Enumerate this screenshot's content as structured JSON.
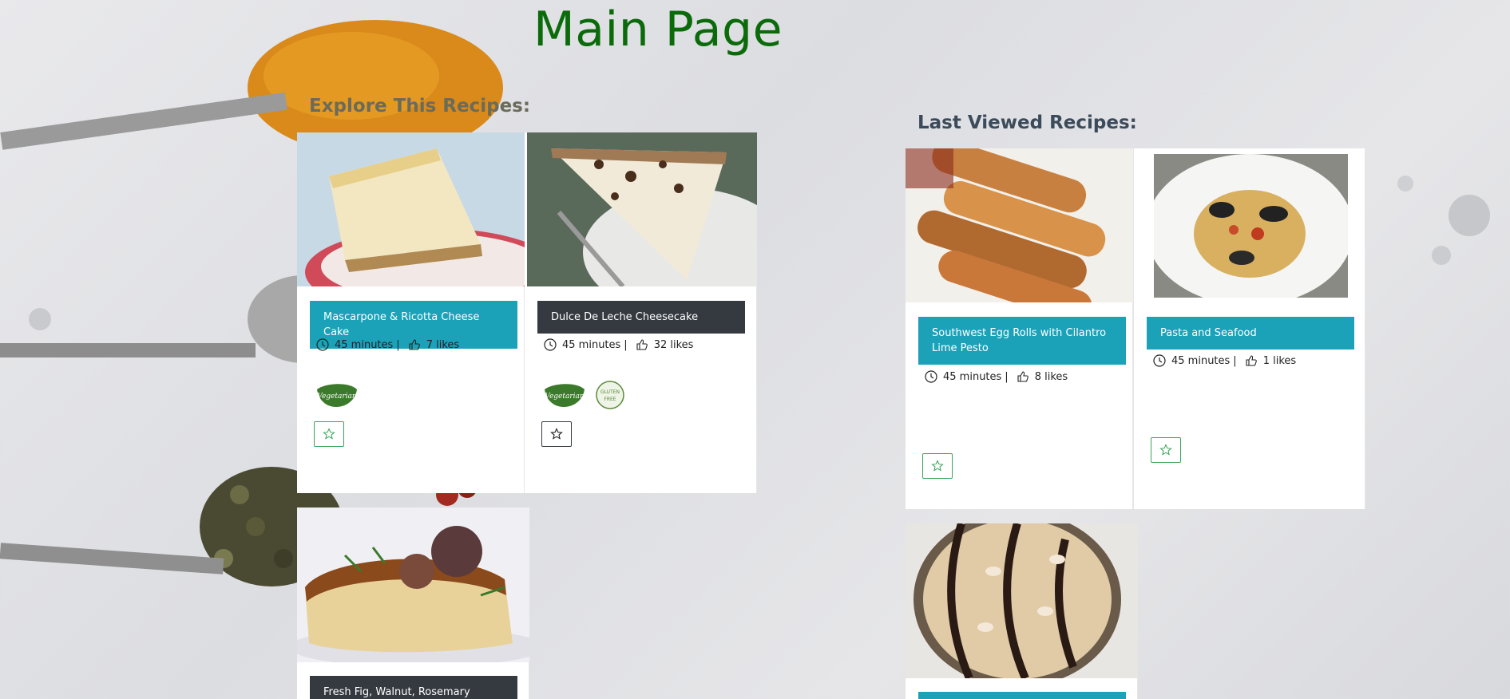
{
  "page": {
    "title": "Main Page"
  },
  "explore": {
    "heading": "Explore This Recipes:",
    "cards": [
      {
        "title": "Mascarpone & Ricotta Cheese Cake",
        "time": "45 minutes",
        "likes": "7 likes",
        "badges": [
          "vegetarian-badge"
        ],
        "favorite_icon": "star-icon",
        "style": "teal"
      },
      {
        "title": "Dulce De Leche Cheesecake",
        "time": "45 minutes",
        "likes": "32 likes",
        "badges": [
          "vegetarian-badge",
          "gluten-free-badge"
        ],
        "favorite_icon": "star-icon",
        "style": "dark"
      },
      {
        "title": "Fresh Fig, Walnut, Rosemary Upside",
        "style": "dark"
      }
    ]
  },
  "last_viewed": {
    "heading": "Last Viewed Recipes:",
    "cards": [
      {
        "title": "Southwest Egg Rolls with Cilantro Lime Pesto",
        "time": "45 minutes",
        "likes": "8 likes",
        "favorite_icon": "star-icon",
        "style": "teal"
      },
      {
        "title": "Pasta and Seafood",
        "time": "45 minutes",
        "likes": "1 likes",
        "favorite_icon": "star-icon",
        "style": "teal"
      },
      {
        "title": "",
        "style": "teal"
      }
    ]
  },
  "badges": {
    "vegetarian": "100% Vegetarian",
    "gluten_free": "GLUTEN FREE"
  },
  "colors": {
    "title_green": "#0b6b0b",
    "teal": "#1ba2b8",
    "dark": "#343a40",
    "star_green": "#3aa35a"
  }
}
